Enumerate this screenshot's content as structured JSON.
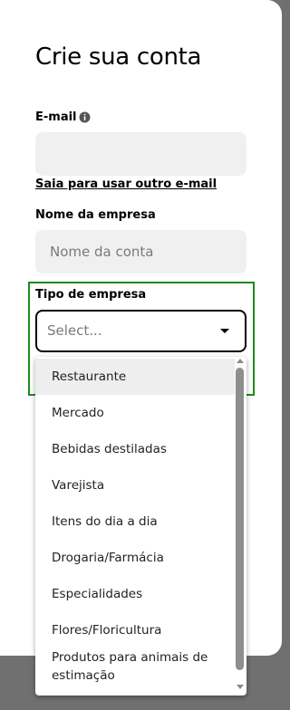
{
  "form": {
    "title": "Crie sua conta",
    "email_label": "E-mail",
    "email_value": "",
    "change_email_link": "Saia para usar outro e-mail",
    "company_name_label": "Nome da empresa",
    "company_name_placeholder": "Nome da conta",
    "company_type_label": "Tipo de empresa",
    "company_type_value": "Select..."
  },
  "dropdown": {
    "options": [
      "Restaurante",
      "Mercado",
      "Bebidas destiladas",
      "Varejista",
      "Itens do dia a dia",
      "Drogaria/Farmácia",
      "Especialidades",
      "Flores/Floricultura",
      "Produtos para animais de estimação"
    ],
    "highlighted_index": 0
  },
  "icons": {
    "email_info": "info-icon",
    "select_caret": "caret-down-icon"
  },
  "colors": {
    "focus_outline": "#1e8a1e",
    "overlay": "#707070"
  }
}
